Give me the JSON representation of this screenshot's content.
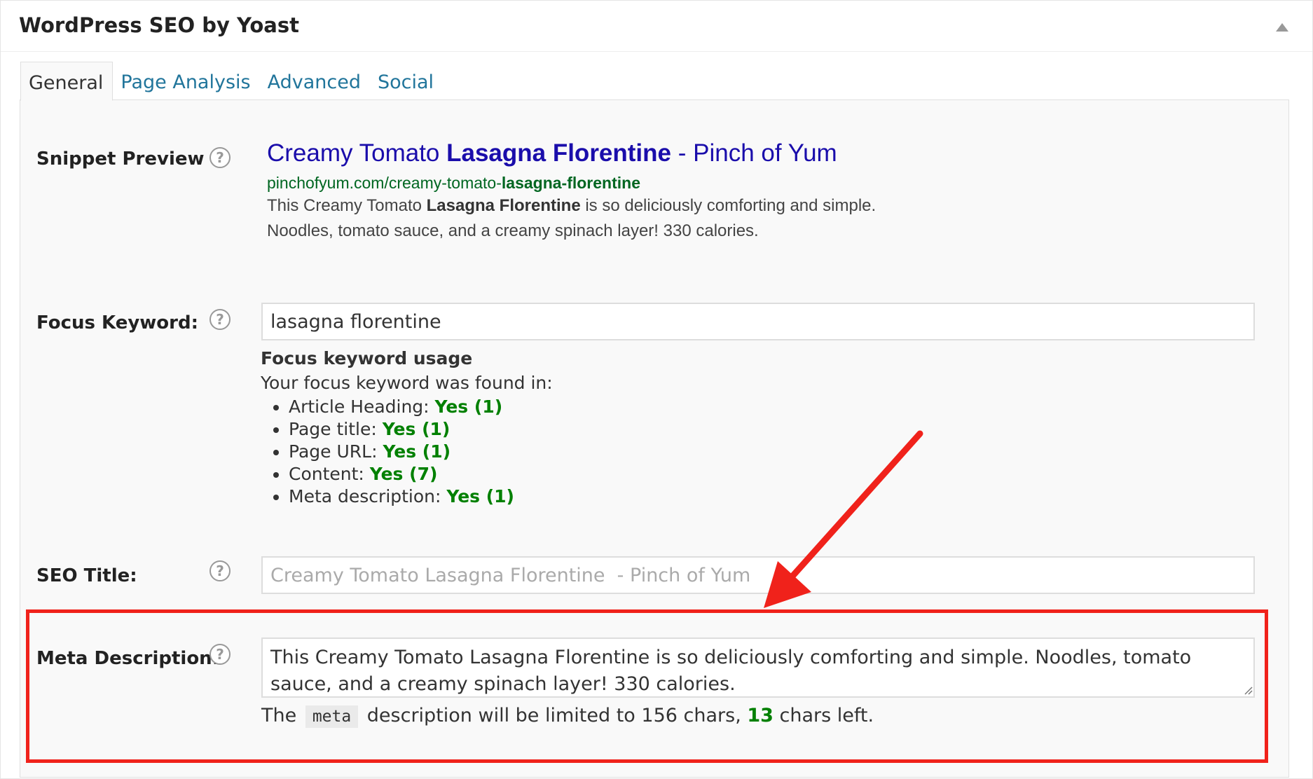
{
  "metabox": {
    "title": "WordPress SEO by Yoast"
  },
  "tabs": [
    {
      "label": "General",
      "active": true
    },
    {
      "label": "Page Analysis",
      "active": false
    },
    {
      "label": "Advanced",
      "active": false
    },
    {
      "label": "Social",
      "active": false
    }
  ],
  "snippet": {
    "label": "Snippet Preview",
    "title_part1": "Creamy Tomato ",
    "title_bold": "Lasagna Florentine",
    "title_part2": " - Pinch of Yum",
    "url_part1": "pinchofyum.com/creamy-tomato-",
    "url_bold": "lasagna-florentine",
    "desc_part1": "This Creamy Tomato ",
    "desc_bold": "Lasagna Florentine",
    "desc_part2": " is so deliciously comforting and simple. Noodles, tomato sauce, and a creamy spinach layer! 330 calories."
  },
  "help_icon": {
    "glyph": "?",
    "icon": "question-circle-icon"
  },
  "focus_keyword": {
    "label": "Focus Keyword:",
    "value": "lasagna florentine",
    "usage_heading": "Focus keyword usage",
    "usage_intro": "Your focus keyword was found in:",
    "items": [
      {
        "label": "Article Heading: ",
        "result": "Yes (1)"
      },
      {
        "label": "Page title: ",
        "result": "Yes (1)"
      },
      {
        "label": "Page URL: ",
        "result": "Yes (1)"
      },
      {
        "label": "Content: ",
        "result": "Yes (7)"
      },
      {
        "label": "Meta description: ",
        "result": "Yes (1)"
      }
    ]
  },
  "seo_title": {
    "label": "SEO Title:",
    "placeholder": "Creamy Tomato Lasagna Florentine  - Pinch of Yum"
  },
  "meta_description": {
    "label": "Meta Description:",
    "value": "This Creamy Tomato Lasagna Florentine is so deliciously comforting and simple. Noodles, tomato sauce, and a creamy spinach layer! 330 calories.",
    "note_prefix": "The ",
    "note_code": "meta",
    "note_middle": " description will be limited to 156 chars, ",
    "chars_left": "13",
    "note_suffix": " chars left."
  },
  "colors": {
    "link": "#21759b",
    "snippet_title": "#1a0dab",
    "snippet_url": "#006621",
    "success": "#008000",
    "highlight": "#f0221b"
  }
}
